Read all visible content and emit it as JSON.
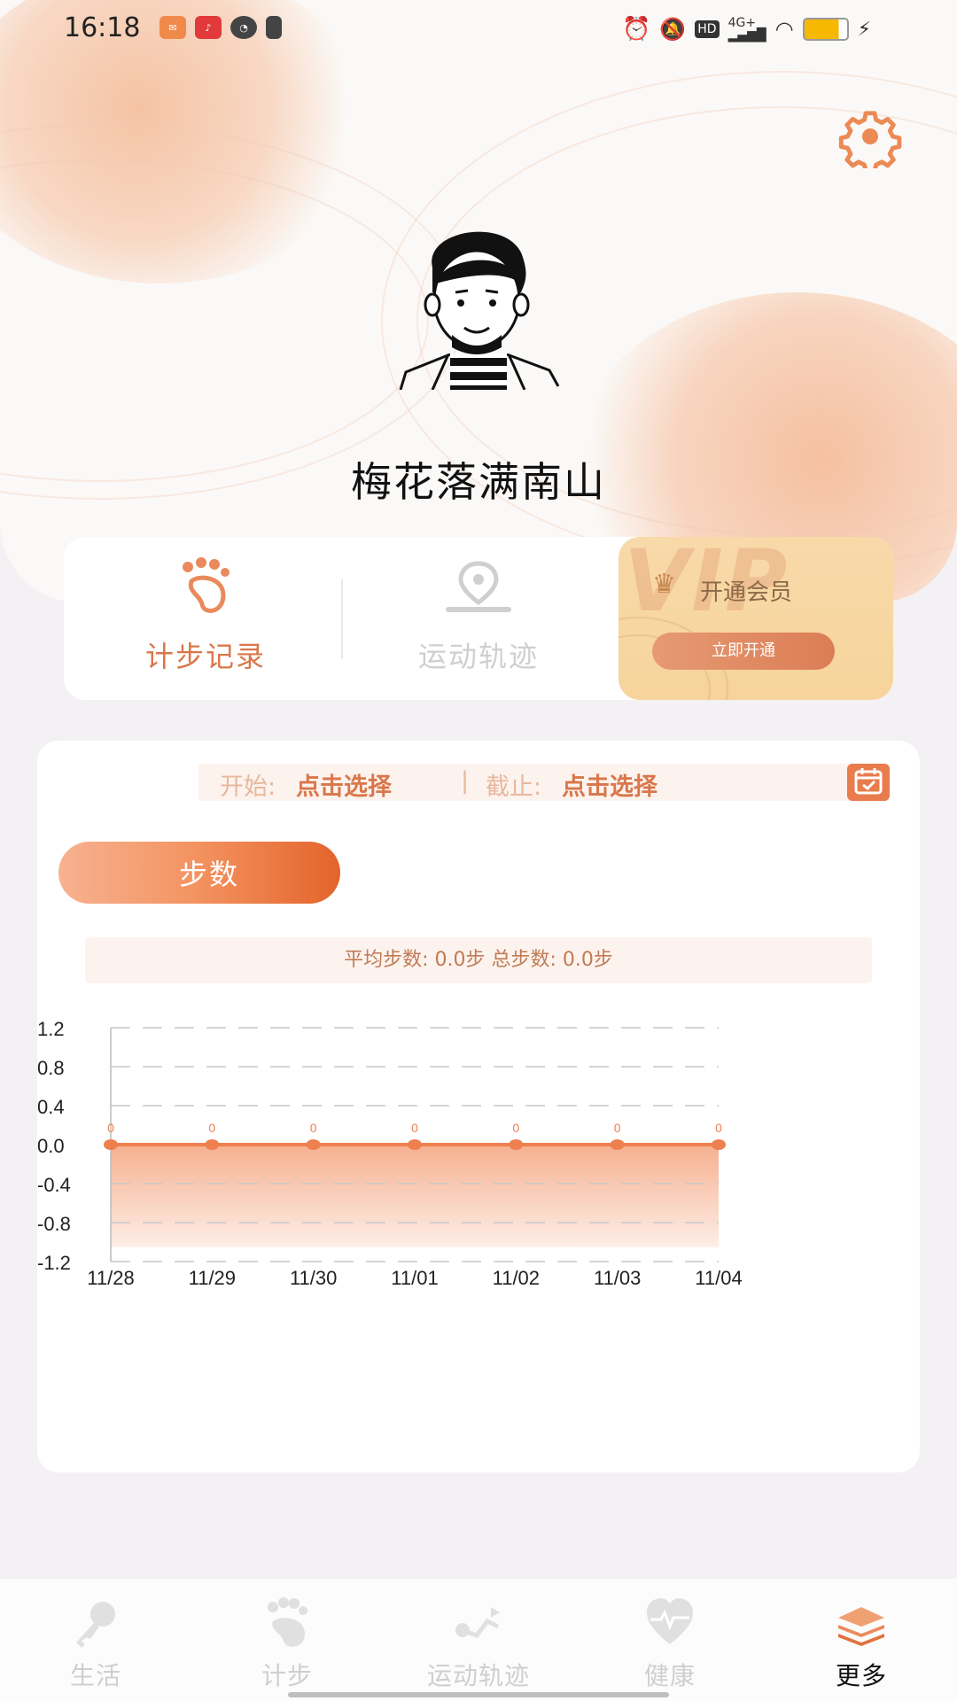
{
  "status_bar": {
    "time": "16:18",
    "network": "4G+",
    "hd": "HD"
  },
  "profile": {
    "username": "梅花落满南山"
  },
  "tabs": [
    {
      "label": "计步记录",
      "icon": "footprint-icon",
      "active": true
    },
    {
      "label": "运动轨迹",
      "icon": "location-pin-icon",
      "active": false
    }
  ],
  "vip": {
    "watermark": "VIP",
    "title": "开通会员",
    "button": "立即开通"
  },
  "date_filter": {
    "start_label": "开始:",
    "start_value": "点击选择",
    "separator": "|",
    "end_label": "截止:",
    "end_value": "点击选择"
  },
  "metric_tab": {
    "label": "步数"
  },
  "summary": {
    "text": "平均步数: 0.0步 总步数: 0.0步"
  },
  "chart_data": {
    "type": "area",
    "x": [
      "11/28",
      "11/29",
      "11/30",
      "11/01",
      "11/02",
      "11/03",
      "11/04"
    ],
    "values": [
      0,
      0,
      0,
      0,
      0,
      0,
      0
    ],
    "data_labels": [
      "0",
      "0",
      "0",
      "0",
      "0",
      "0",
      "0"
    ],
    "yticks": [
      "1.2",
      "0.8",
      "0.4",
      "0.0",
      "-0.4",
      "-0.8",
      "-1.2"
    ],
    "ylim": [
      -1.2,
      1.2
    ],
    "grid": true,
    "color": "#ee7f4f"
  },
  "bottom_nav": [
    {
      "label": "生活",
      "icon": "key-icon",
      "active": false
    },
    {
      "label": "计步",
      "icon": "footprint-icon",
      "active": false
    },
    {
      "label": "运动轨迹",
      "icon": "route-icon",
      "active": false
    },
    {
      "label": "健康",
      "icon": "heart-pulse-icon",
      "active": false
    },
    {
      "label": "更多",
      "icon": "layers-icon",
      "active": true
    }
  ],
  "colors": {
    "accent": "#e98a5c",
    "active_text": "#d9774a",
    "inactive_text": "#d0cfcf"
  }
}
